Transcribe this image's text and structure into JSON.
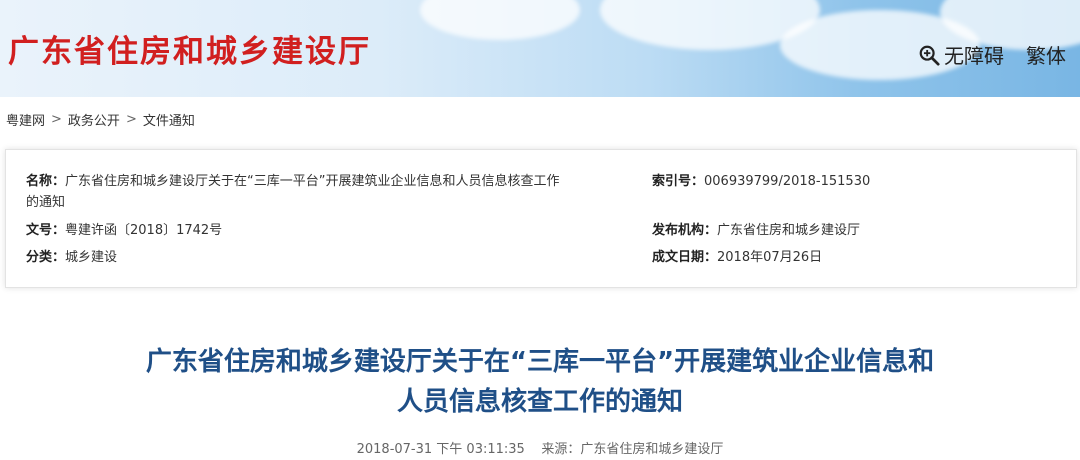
{
  "header": {
    "site_title": "广东省住房和城乡建设厅",
    "accessibility_label": "无障碍",
    "traditional_label": "繁体"
  },
  "breadcrumb": [
    "粤建网",
    "政务公开",
    "文件通知"
  ],
  "breadcrumb_separator": ">",
  "meta": {
    "name_label": "名称：",
    "name_value_line1": "广东省住房和城乡建设厅关于在“三库一平台”开展建筑业企业信息和人员信息核查工作",
    "name_value_line2": "的通知",
    "index_label": "索引号：",
    "index_value": "006939799/2018-151530",
    "doc_no_label": "文号：",
    "doc_no_value": "粤建许函〔2018〕1742号",
    "publisher_label": "发布机构：",
    "publisher_value": "广东省住房和城乡建设厅",
    "category_label": "分类：",
    "category_value": "城乡建设",
    "date_label": "成文日期：",
    "date_value": "2018年07月26日"
  },
  "article": {
    "title_line1": "广东省住房和城乡建设厅关于在“三库一平台”开展建筑业企业信息和",
    "title_line2": "人员信息核查工作的通知",
    "published_at": "2018-07-31 下午 03:11:35",
    "source_label": "来源：",
    "source_value": "广东省住房和城乡建设厅"
  },
  "icons": {
    "accessibility": "magnifier-plus-icon"
  }
}
